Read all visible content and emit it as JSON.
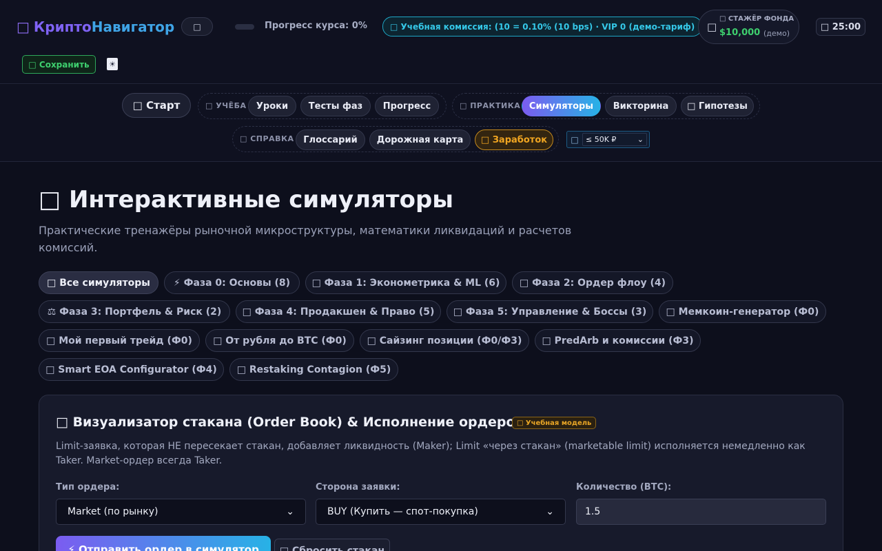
{
  "header": {
    "logo_icon": "□",
    "logo_part1": "Крипто",
    "logo_part2": "Навигатор",
    "menu_pill_icon": "□",
    "progress_label": "Прогресс курса: 0%",
    "progress_value": 0,
    "fee_pill": "□ Учебная комиссия: (10 = 0.10% (10 bps) · VIP 0 (демо-тариф)",
    "trainee": {
      "icon": "□",
      "label": "□ СТАЖЁР ФОНДА",
      "amount": "$10,000",
      "demo": "(демо)"
    },
    "timer": "□ 25:00",
    "save_label": "□ Сохранить",
    "theme_icon": "☀"
  },
  "nav": {
    "start": "□ Старт",
    "study": {
      "label": "□ УЧЁБА",
      "items": [
        "Уроки",
        "Тесты фаз",
        "Прогресс"
      ]
    },
    "practice": {
      "label": "□ ПРАКТИКА",
      "items": [
        "Симуляторы",
        "Викторина",
        "□ Гипотезы"
      ],
      "active": "Симуляторы"
    },
    "reference": {
      "label": "□ СПРАВКА",
      "items": [
        "Глоссарий",
        "Дорожная карта",
        "□ Заработок"
      ]
    },
    "budget": {
      "icon": "□",
      "value": "≤ 50K ₽"
    }
  },
  "main": {
    "title": "□ Интерактивные симуляторы",
    "subtitle": "Практические тренажёры рыночной микроструктуры, математики ликвидаций и расчетов комиссий.",
    "filters": [
      "□ Все симуляторы",
      "⚡ Фаза 0: Основы (8)",
      "□ Фаза 1: Эконометрика & ML (6)",
      "□ Фаза 2: Ордер флоу (4)",
      "⚖ Фаза 3: Портфель & Риск (2)",
      "□ Фаза 4: Продакшен & Право (5)",
      "□ Фаза 5: Управление & Боссы (3)",
      "□ Мемкоин-генератор (Ф0)",
      "□ Мой первый трейд (Ф0)",
      "□ От рубля до BTC (Ф0)",
      "□ Сайзинг позиции (Ф0/Ф3)",
      "□ PredArb и комиссии (Ф3)",
      "□ Smart EOA Configurator (Ф4)",
      "□ Restaking Contagion (Ф5)"
    ],
    "card": {
      "title": "□ Визуализатор стакана (Order Book) & Исполнение ордеров",
      "badge": "□ Учебная модель",
      "description": "Limit-заявка, которая НЕ пересекает стакан, добавляет ликвидность (Maker); Limit «через стакан» (marketable limit) исполняется немедленно как Taker. Market-ордер всегда Taker.",
      "order_type_label": "Тип ордера:",
      "order_type_value": "Market (по рынку)",
      "side_label": "Сторона заявки:",
      "side_value": "BUY (Купить — спот-покупка)",
      "qty_label": "Количество (BTC):",
      "qty_value": "1.5",
      "submit_label": "⚡ Отправить ордер в симулятор",
      "reset_label": "□ Сбросить стакан"
    }
  },
  "colors": {
    "accent": "#7b5cf0",
    "accent2": "#27b2e6",
    "success": "#3ecf6e",
    "warning": "#f0a521",
    "fee": "#35c8e8"
  }
}
